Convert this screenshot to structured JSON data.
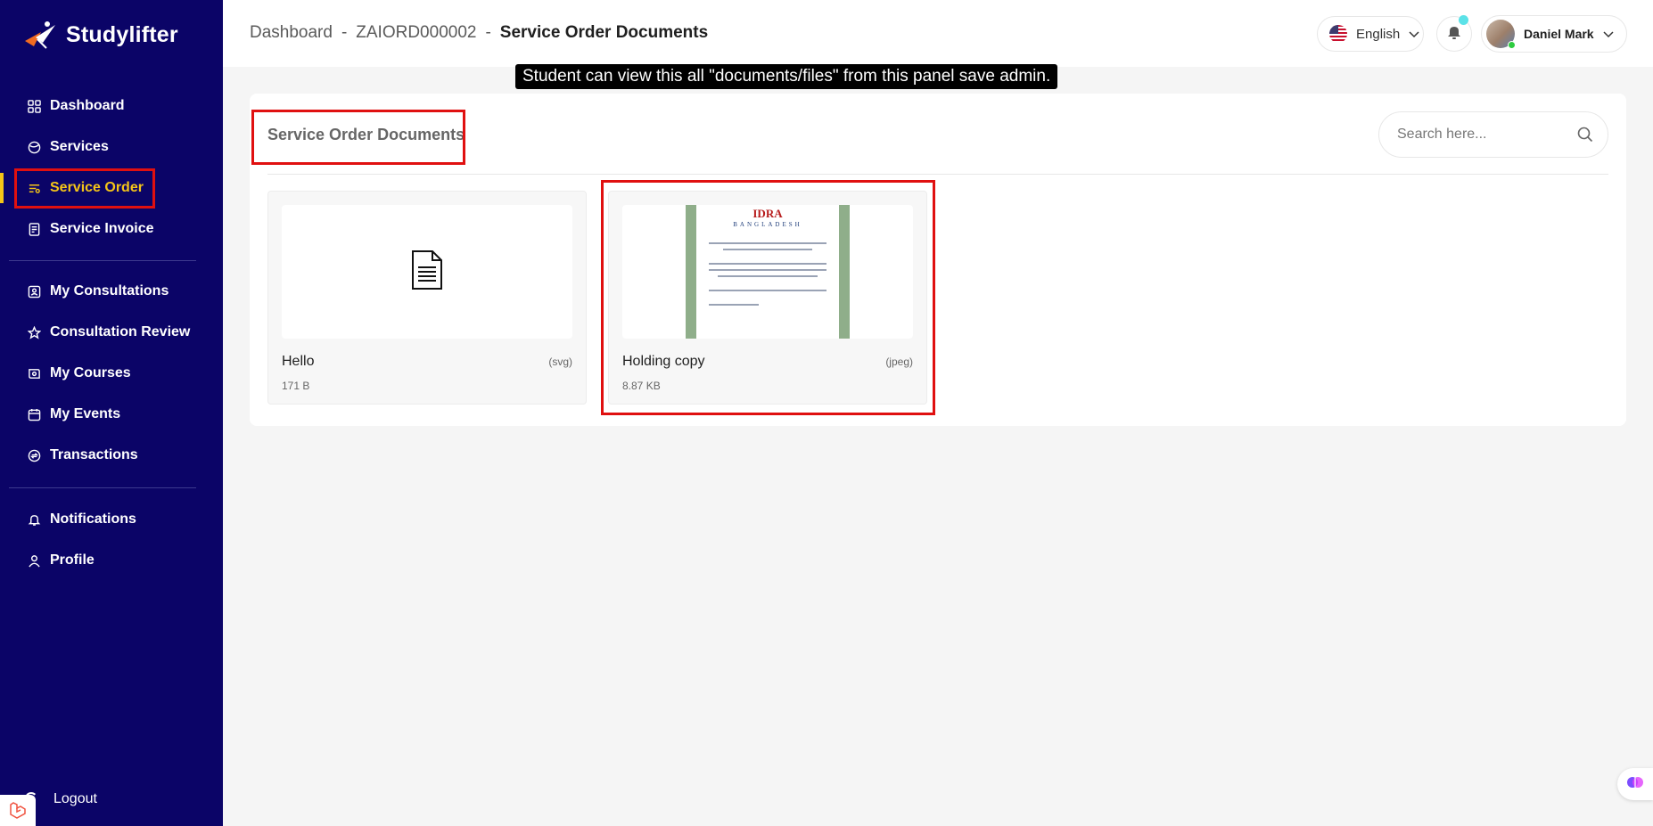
{
  "app": {
    "name": "Studylifter"
  },
  "sidebar": {
    "group1": [
      {
        "label": "Dashboard",
        "icon": "grid-icon"
      },
      {
        "label": "Services",
        "icon": "globe-icon"
      },
      {
        "label": "Service Order",
        "icon": "list-filter-icon",
        "active": true
      },
      {
        "label": "Service Invoice",
        "icon": "invoice-icon"
      }
    ],
    "group2": [
      {
        "label": "My Consultations",
        "icon": "user-card-icon"
      },
      {
        "label": "Consultation Review",
        "icon": "star-icon"
      },
      {
        "label": "My Courses",
        "icon": "course-icon"
      },
      {
        "label": "My Events",
        "icon": "calendar-icon"
      },
      {
        "label": "Transactions",
        "icon": "transaction-icon"
      }
    ],
    "group3": [
      {
        "label": "Notifications",
        "icon": "bell-icon"
      },
      {
        "label": "Profile",
        "icon": "user-icon"
      }
    ],
    "logout_label": "Logout"
  },
  "header": {
    "breadcrumb": [
      "Dashboard",
      "ZAIORD000002",
      "Service Order Documents"
    ],
    "separator": "-",
    "language": "English",
    "user_name": "Daniel Mark"
  },
  "annotation": "Student can view this all \"documents/files\" from this panel save admin.",
  "main": {
    "title": "Service Order Documents",
    "search_placeholder": "Search here...",
    "documents": [
      {
        "name": "Hello",
        "ext": "(svg)",
        "size": "171 B",
        "preview": "file-icon"
      },
      {
        "name": "Holding copy",
        "ext": "(jpeg)",
        "size": "8.87 KB",
        "preview": "certificate-image",
        "preview_text": {
          "title": "IDRA",
          "subtitle": "BANGLADESH"
        }
      }
    ]
  },
  "colors": {
    "sidebar": "#0b0467",
    "accent": "#f5c518",
    "highlight": "#e01010"
  }
}
